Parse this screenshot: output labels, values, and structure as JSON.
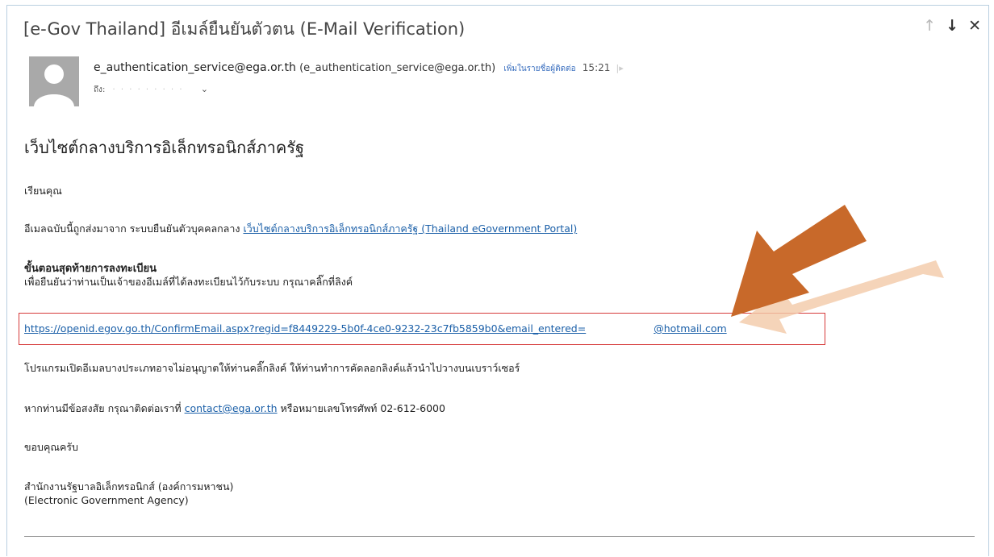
{
  "header": {
    "subject": "[e-Gov Thailand] อีเมล์ยืนยันตัวตน (E-Mail Verification)",
    "nav_up_icon": "arrow-up-icon",
    "nav_down_icon": "arrow-down-icon",
    "close_icon": "close-icon"
  },
  "sender": {
    "email": "e_authentication_service@ega.or.th",
    "email_paren": "(e_authentication_service@ega.or.th)",
    "add_contact": "เพิ่มในรายชื่อผู้ติดต่อ",
    "time": "15:21",
    "to_label": "ถึง:"
  },
  "body": {
    "heading": "เว็บไซต์กลางบริการอิเล็กทรอนิกส์ภาครัฐ",
    "greeting": "เรียนคุณ",
    "intro_text": "อีเมลฉบับนี้ถูกส่งมาจาก ระบบยืนยันตัวบุคคลกลาง",
    "portal_link": "เว็บไซต์กลางบริการอิเล็กทรอนิกส์ภาครัฐ (Thailand eGovernment Portal)",
    "step_title": "ขั้นตอนสุดท้ายการลงทะเบียน",
    "step_text": "เพื่อยืนยันว่าท่านเป็นเจ้าของอีเมล์ที่ได้ลงทะเบียนไว้กับระบบ กรุณาคลิ๊กที่ลิงค์",
    "confirm_link": "https://openid.egov.go.th/ConfirmEmail.aspx?regid=f8449229-5b0f-4ce0-9232-23c7fb5859b0&email_entered=",
    "confirm_link_tail": "@hotmail.com",
    "program_note": "โปรแกรมเปิดอีเมลบางประเภทอาจไม่อนุญาตให้ท่านคลิ๊กลิงค์ ให้ท่านทำการคัดลอกลิงค์แล้วนำไปวางบนเบราว์เซอร์",
    "contact_text": "หากท่านมีข้อสงสัย กรุณาติดต่อเราที่",
    "contact_email": "contact@ega.or.th",
    "contact_phone": "หรือหมายเลขโทรศัพท์ 02-612-6000",
    "thanks": "ขอบคุณครับ",
    "org_th": "สำนักงานรัฐบาลอิเล็กทรอนิกส์ (องค์การมหาชน)",
    "org_en": "(Electronic Government Agency)"
  },
  "colors": {
    "link": "#1a5fa8",
    "highlight_box": "#d63a3a",
    "arrow": "#c8692a",
    "arrow_ghost": "#f2c9a8"
  }
}
